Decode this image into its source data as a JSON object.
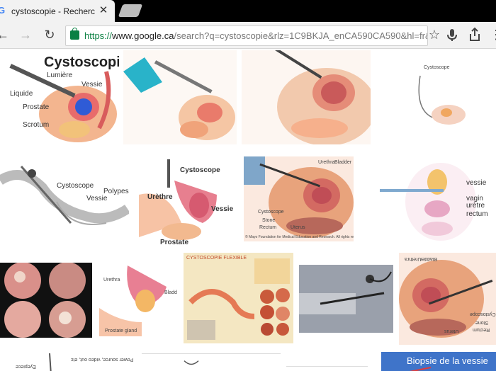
{
  "browser": {
    "tab_title": "cystoscopie - Recherche Go",
    "tab_favicon": "google-g-icon",
    "url_scheme": "https://",
    "url_host": "www.google.ca",
    "url_path": "/search?q=cystoscopie&rlz=1C9BKJA_enCA590CA590&hl=fr&tbm=isch",
    "accent_secure": "#0b8043"
  },
  "toolbar": {
    "icons": [
      "back-icon",
      "forward-icon",
      "reload-icon",
      "secure-lock-icon",
      "bookmark-star-icon",
      "microphone-icon",
      "share-icon",
      "menu-icon"
    ]
  },
  "results": {
    "r1": {
      "title": "Cystoscopie",
      "labels": [
        "Lumière",
        "Vessie",
        "Liquide",
        "Prostate",
        "Scrotum"
      ]
    },
    "r4": {
      "labels": [
        "Cystoscope"
      ]
    },
    "r5": {
      "labels": [
        "Cystoscope",
        "Vessie",
        "Polypes"
      ]
    },
    "r6": {
      "labels": [
        "Cystoscope",
        "Urèthre",
        "Vessie",
        "Prostate"
      ]
    },
    "r7": {
      "labels": [
        "Urethra",
        "Bladder",
        "Cystoscope",
        "Stone",
        "Rectum",
        "Uterus"
      ],
      "footer": "© Mayo Foundation for Medical Education and Research. All rights reserved."
    },
    "r8": {
      "labels": [
        "vessie",
        "vagin",
        "urètre",
        "rectum"
      ]
    },
    "r10": {
      "labels": [
        "Urethra",
        "Bladder",
        "Prostate gland"
      ]
    },
    "r11": {
      "title": "CYSTOSCOPIE FLEXIBLE"
    },
    "r13": {
      "labels": [
        "Urethra",
        "Bladder",
        "Cystoscope",
        "Stone",
        "Rectum",
        "Uterus"
      ]
    },
    "r14": {
      "labels": [
        "Eyepiece"
      ]
    },
    "r15": {
      "labels": [
        "Power source, video out, etc"
      ]
    },
    "r18": {
      "title": "Biopsie de la vessie"
    }
  }
}
